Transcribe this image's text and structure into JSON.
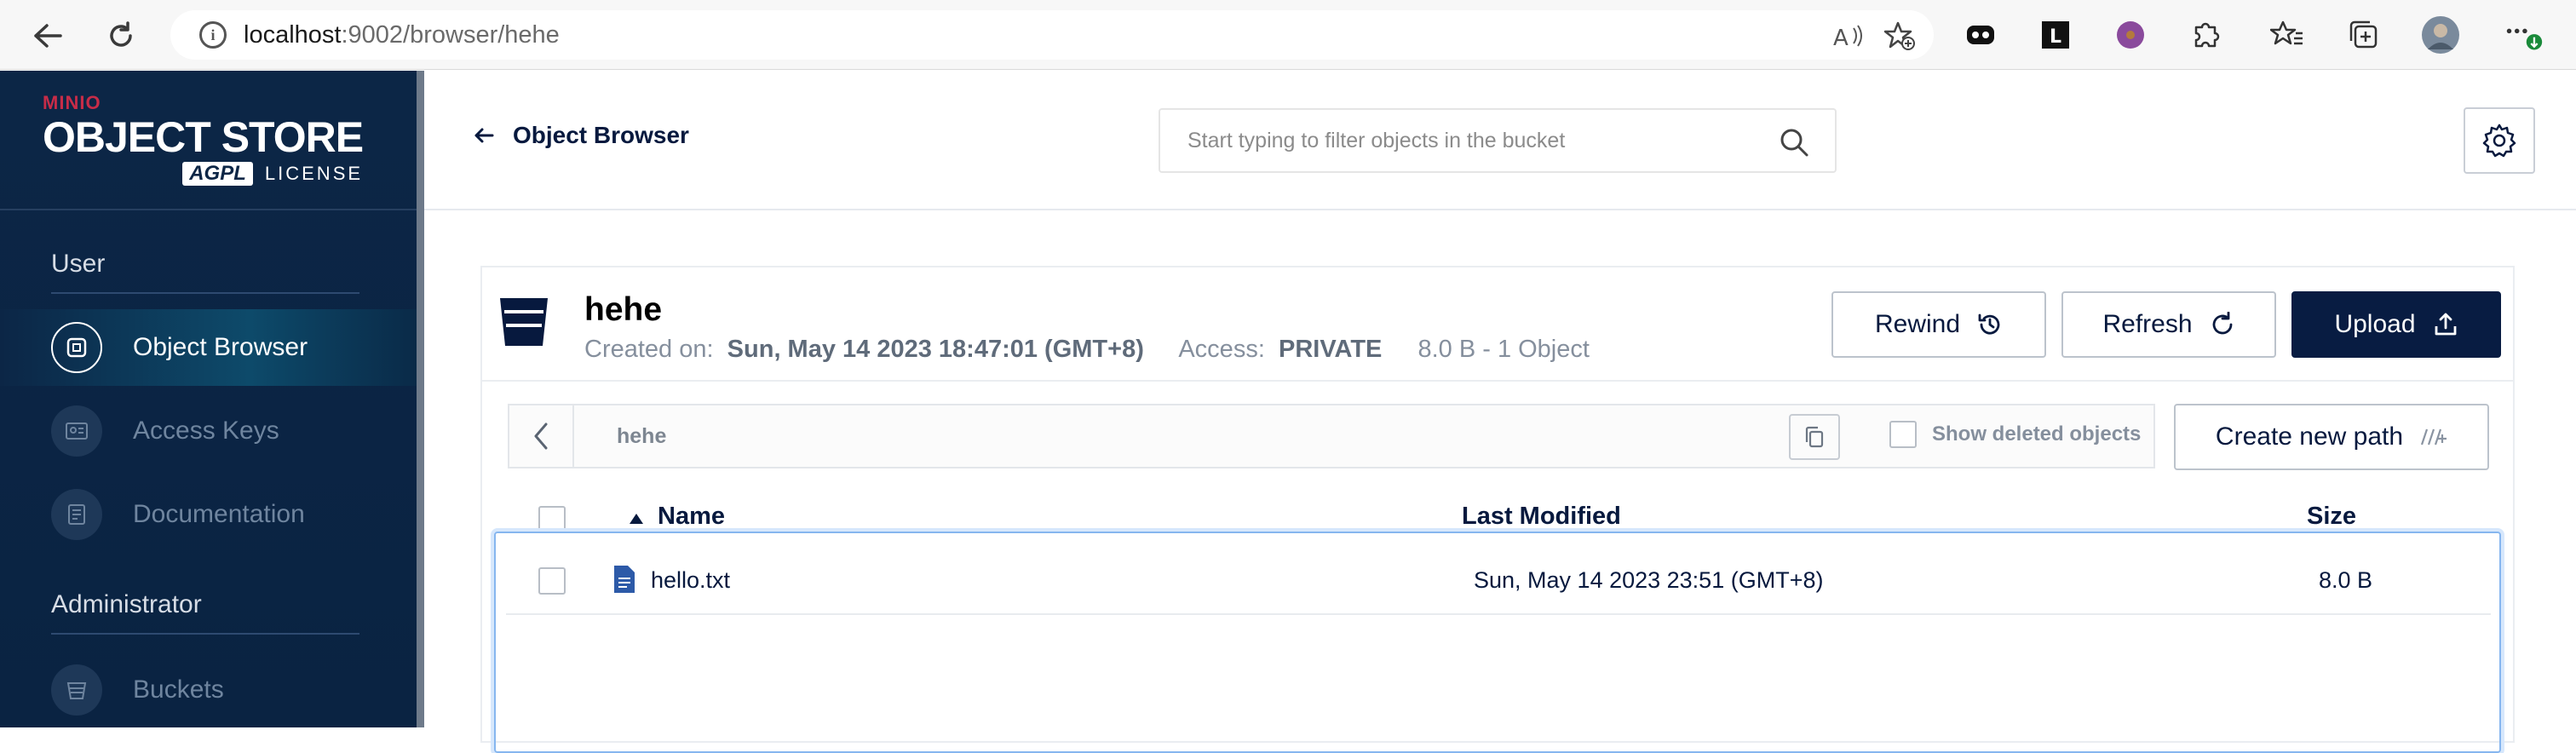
{
  "browser": {
    "url_host": "localhost",
    "url_path": ":9002/browser/hehe",
    "extensions": [
      "copilot-icon",
      "l-extension-icon",
      "purple-circle-extension-icon",
      "puzzle-icon"
    ]
  },
  "sidebar": {
    "logo": {
      "brand": "MINIO",
      "product": "OBJECT STORE",
      "license_badge": "AGPL",
      "license_label": "LICENSE"
    },
    "sections": [
      {
        "title": "User",
        "items": [
          {
            "label": "Object Browser",
            "icon": "object-browser-icon",
            "active": true
          },
          {
            "label": "Access Keys",
            "icon": "access-keys-icon",
            "active": false
          },
          {
            "label": "Documentation",
            "icon": "documentation-icon",
            "active": false
          }
        ]
      },
      {
        "title": "Administrator",
        "items": [
          {
            "label": "Buckets",
            "icon": "buckets-icon",
            "active": false
          }
        ]
      }
    ]
  },
  "header": {
    "back_label": "Object Browser",
    "search_placeholder": "Start typing to filter objects in the bucket"
  },
  "bucket": {
    "name": "hehe",
    "created_label": "Created on:",
    "created_value": "Sun, May 14 2023 18:47:01 (GMT+8)",
    "access_label": "Access:",
    "access_value": "PRIVATE",
    "usage": "8.0 B - 1 Object",
    "buttons": {
      "rewind": "Rewind",
      "refresh": "Refresh",
      "upload": "Upload"
    }
  },
  "path_bar": {
    "breadcrumb": "hehe",
    "show_deleted_label": "Show deleted objects",
    "create_path_label": "Create new path"
  },
  "table": {
    "columns": {
      "name": "Name",
      "modified": "Last Modified",
      "size": "Size"
    },
    "rows": [
      {
        "name": "hello.txt",
        "modified": "Sun, May 14 2023 23:51 (GMT+8)",
        "size": "8.0 B"
      }
    ]
  },
  "colors": {
    "sidebar_bg": "#0c2646",
    "primary": "#081c42",
    "accent_brand": "#c72c48",
    "selection_border": "#86b6ef"
  }
}
